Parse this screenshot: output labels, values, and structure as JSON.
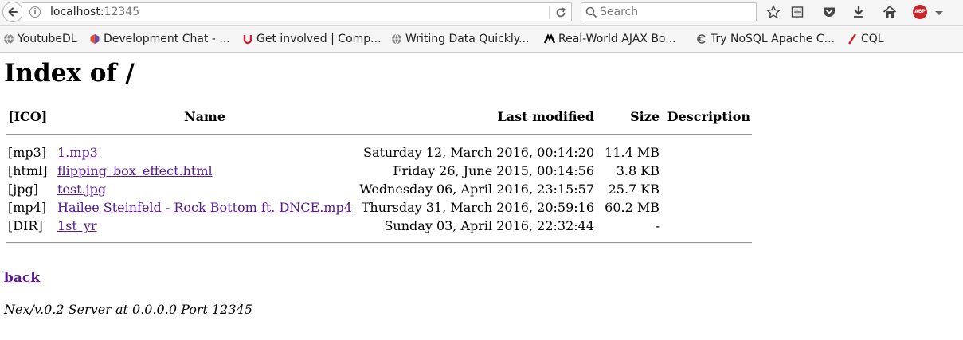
{
  "browser": {
    "url_host": "localhost:",
    "url_port": "12345",
    "search_placeholder": "Search",
    "abp_label": "ABP"
  },
  "bookmarks": [
    {
      "label": "YoutubeDL",
      "icon": "globe-icon",
      "color": "#777777"
    },
    {
      "label": "Development Chat - ...",
      "icon": "hexagon-logo-icon",
      "color": "#e0533d"
    },
    {
      "label": "Get involved | Comp...",
      "icon": "u-logo-icon",
      "color": "#c8202f"
    },
    {
      "label": "Writing Data Quickly...",
      "icon": "globe-icon",
      "color": "#777777"
    },
    {
      "label": "Real-World AJAX Bo...",
      "icon": "ajax-logo-icon",
      "color": "#000000"
    },
    {
      "label": "Try NoSQL Apache C...",
      "icon": "spiral-logo-icon",
      "color": "#555555"
    },
    {
      "label": "CQL",
      "icon": "feather-icon",
      "color": "#d0202e"
    }
  ],
  "page": {
    "title": "Index of /",
    "columns": {
      "icon": "[ICO]",
      "name": "Name",
      "last_modified": "Last modified",
      "size": "Size",
      "description": "Description"
    },
    "rows": [
      {
        "type": "[mp3]",
        "name": "1.mp3",
        "modified": "Saturday 12, March 2016, 00:14:20",
        "size": "11.4 MB"
      },
      {
        "type": "[html]",
        "name": "flipping_box_effect.html",
        "modified": "Friday 26, June 2015, 00:14:56",
        "size": "3.8 KB"
      },
      {
        "type": "[jpg]",
        "name": "test.jpg",
        "modified": "Wednesday 06, April 2016, 23:15:57",
        "size": "25.7 KB"
      },
      {
        "type": "[mp4]",
        "name": "Hailee Steinfeld - Rock Bottom ft. DNCE.mp4",
        "modified": "Thursday 31, March 2016, 20:59:16",
        "size": "60.2 MB"
      },
      {
        "type": "[DIR]",
        "name": "1st_yr",
        "modified": "Sunday 03, April 2016, 22:32:44",
        "size": "-"
      }
    ],
    "back_link": "back",
    "server_signature": "Nex/v.0.2 Server at 0.0.0.0 Port 12345"
  },
  "colors": {
    "link": "#551a8b",
    "chrome_bg": "#f5f5f5"
  }
}
